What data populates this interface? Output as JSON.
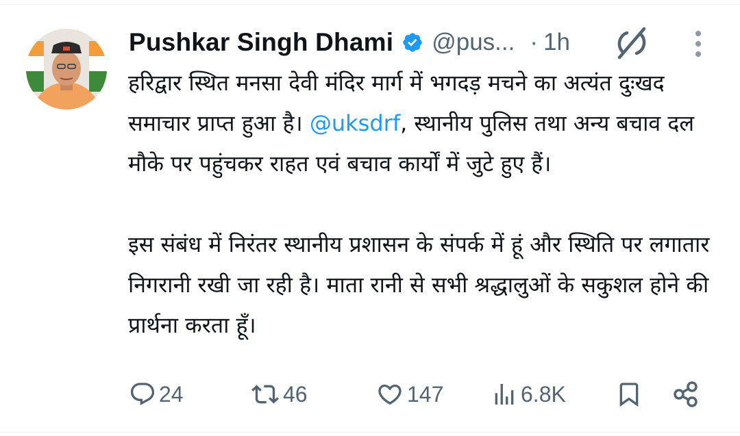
{
  "author": {
    "name": "Pushkar Singh Dhami",
    "handle": "@pus...",
    "separator": "·",
    "time": "1h"
  },
  "tweet": {
    "para1_a": "हरिद्वार स्थित मनसा देवी मंदिर मार्ग में भगदड़ मचने का अत्यंत दुःखद समाचार प्राप्त हुआ है। ",
    "mention": "@uksdrf",
    "para1_b": ", स्थानीय पुलिस तथा अन्य बचाव दल मौके पर पहुंचकर राहत एवं बचाव कार्यों में जुटे हुए हैं।",
    "para2": "इस संबंध में निरंतर स्थानीय प्रशासन के संपर्क में हूं और स्थिति पर लगातार निगरानी रखी जा रही है। माता रानी से सभी श्रद्धालुओं के सकुशल होने की प्रार्थना करता हूँ।"
  },
  "metrics": {
    "replies": "24",
    "reposts": "46",
    "likes": "147",
    "views": "6.8K"
  },
  "icons": {
    "verified": "verified-badge-icon",
    "grok": "grok-icon",
    "more": "more-vertical-icon",
    "reply": "reply-icon",
    "repost": "repost-icon",
    "like": "like-icon",
    "views": "views-icon",
    "bookmark": "bookmark-icon",
    "share": "share-icon"
  },
  "colors": {
    "text": "#0f1419",
    "secondary": "#536471",
    "accent": "#1d9bf0"
  }
}
